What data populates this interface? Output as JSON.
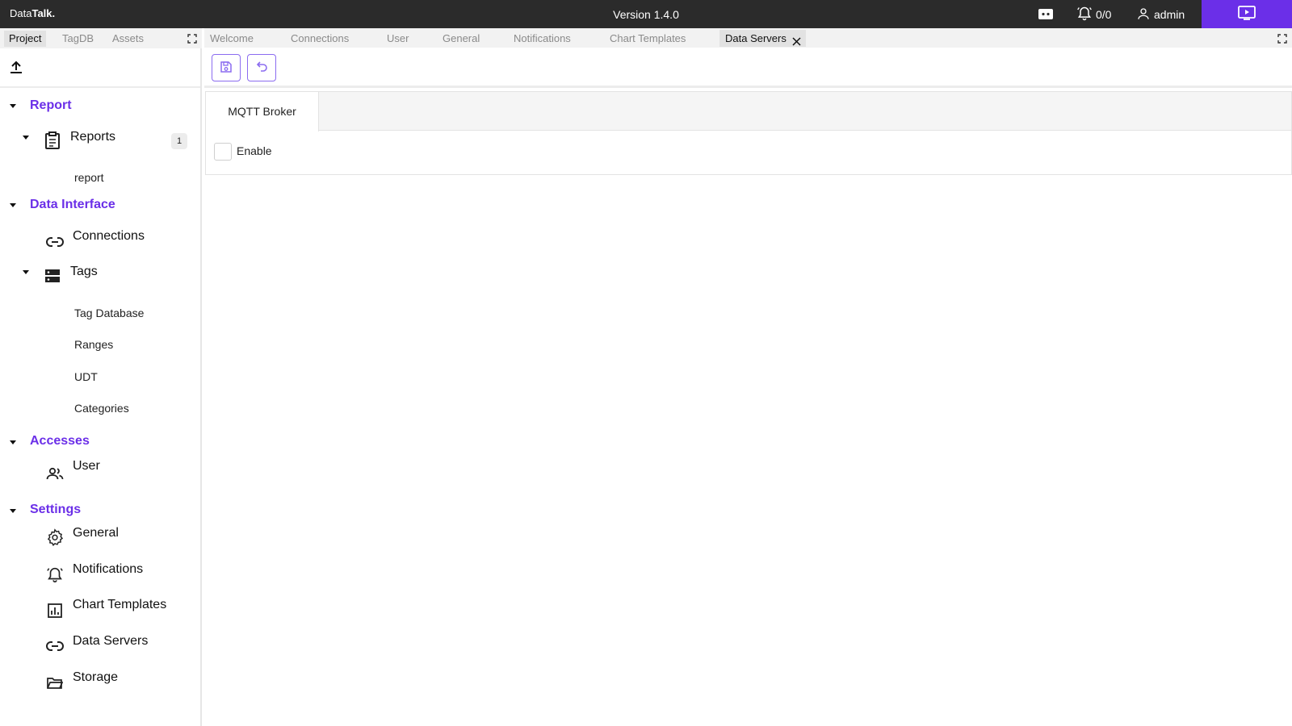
{
  "topbar": {
    "brand_prefix": "Data",
    "brand_bold": "Talk.",
    "version": "Version 1.4.0",
    "alarm_count": "0/0",
    "user_name": "admin",
    "accent_color": "#6b2fe8"
  },
  "left_tabs": [
    "Project",
    "TagDB",
    "Assets"
  ],
  "tree": {
    "report_section": "Report",
    "reports_label": "Reports",
    "reports_badge": "1",
    "report_item": "report",
    "data_interface_section": "Data Interface",
    "connections_label": "Connections",
    "tags_label": "Tags",
    "tag_database": "Tag Database",
    "ranges": "Ranges",
    "udt": "UDT",
    "categories": "Categories",
    "accesses_section": "Accesses",
    "user_label": "User",
    "settings_section": "Settings",
    "general_label": "General",
    "notifications_label": "Notifications",
    "chart_templates_label": "Chart Templates",
    "data_servers_label": "Data Servers",
    "storage_label": "Storage"
  },
  "editor_tabs": [
    "Welcome",
    "Connections",
    "User",
    "General",
    "Notifications",
    "Chart Templates",
    "Data Servers"
  ],
  "panel": {
    "tab_label": "MQTT Broker",
    "enable_label": "Enable",
    "enable_checked": false
  }
}
